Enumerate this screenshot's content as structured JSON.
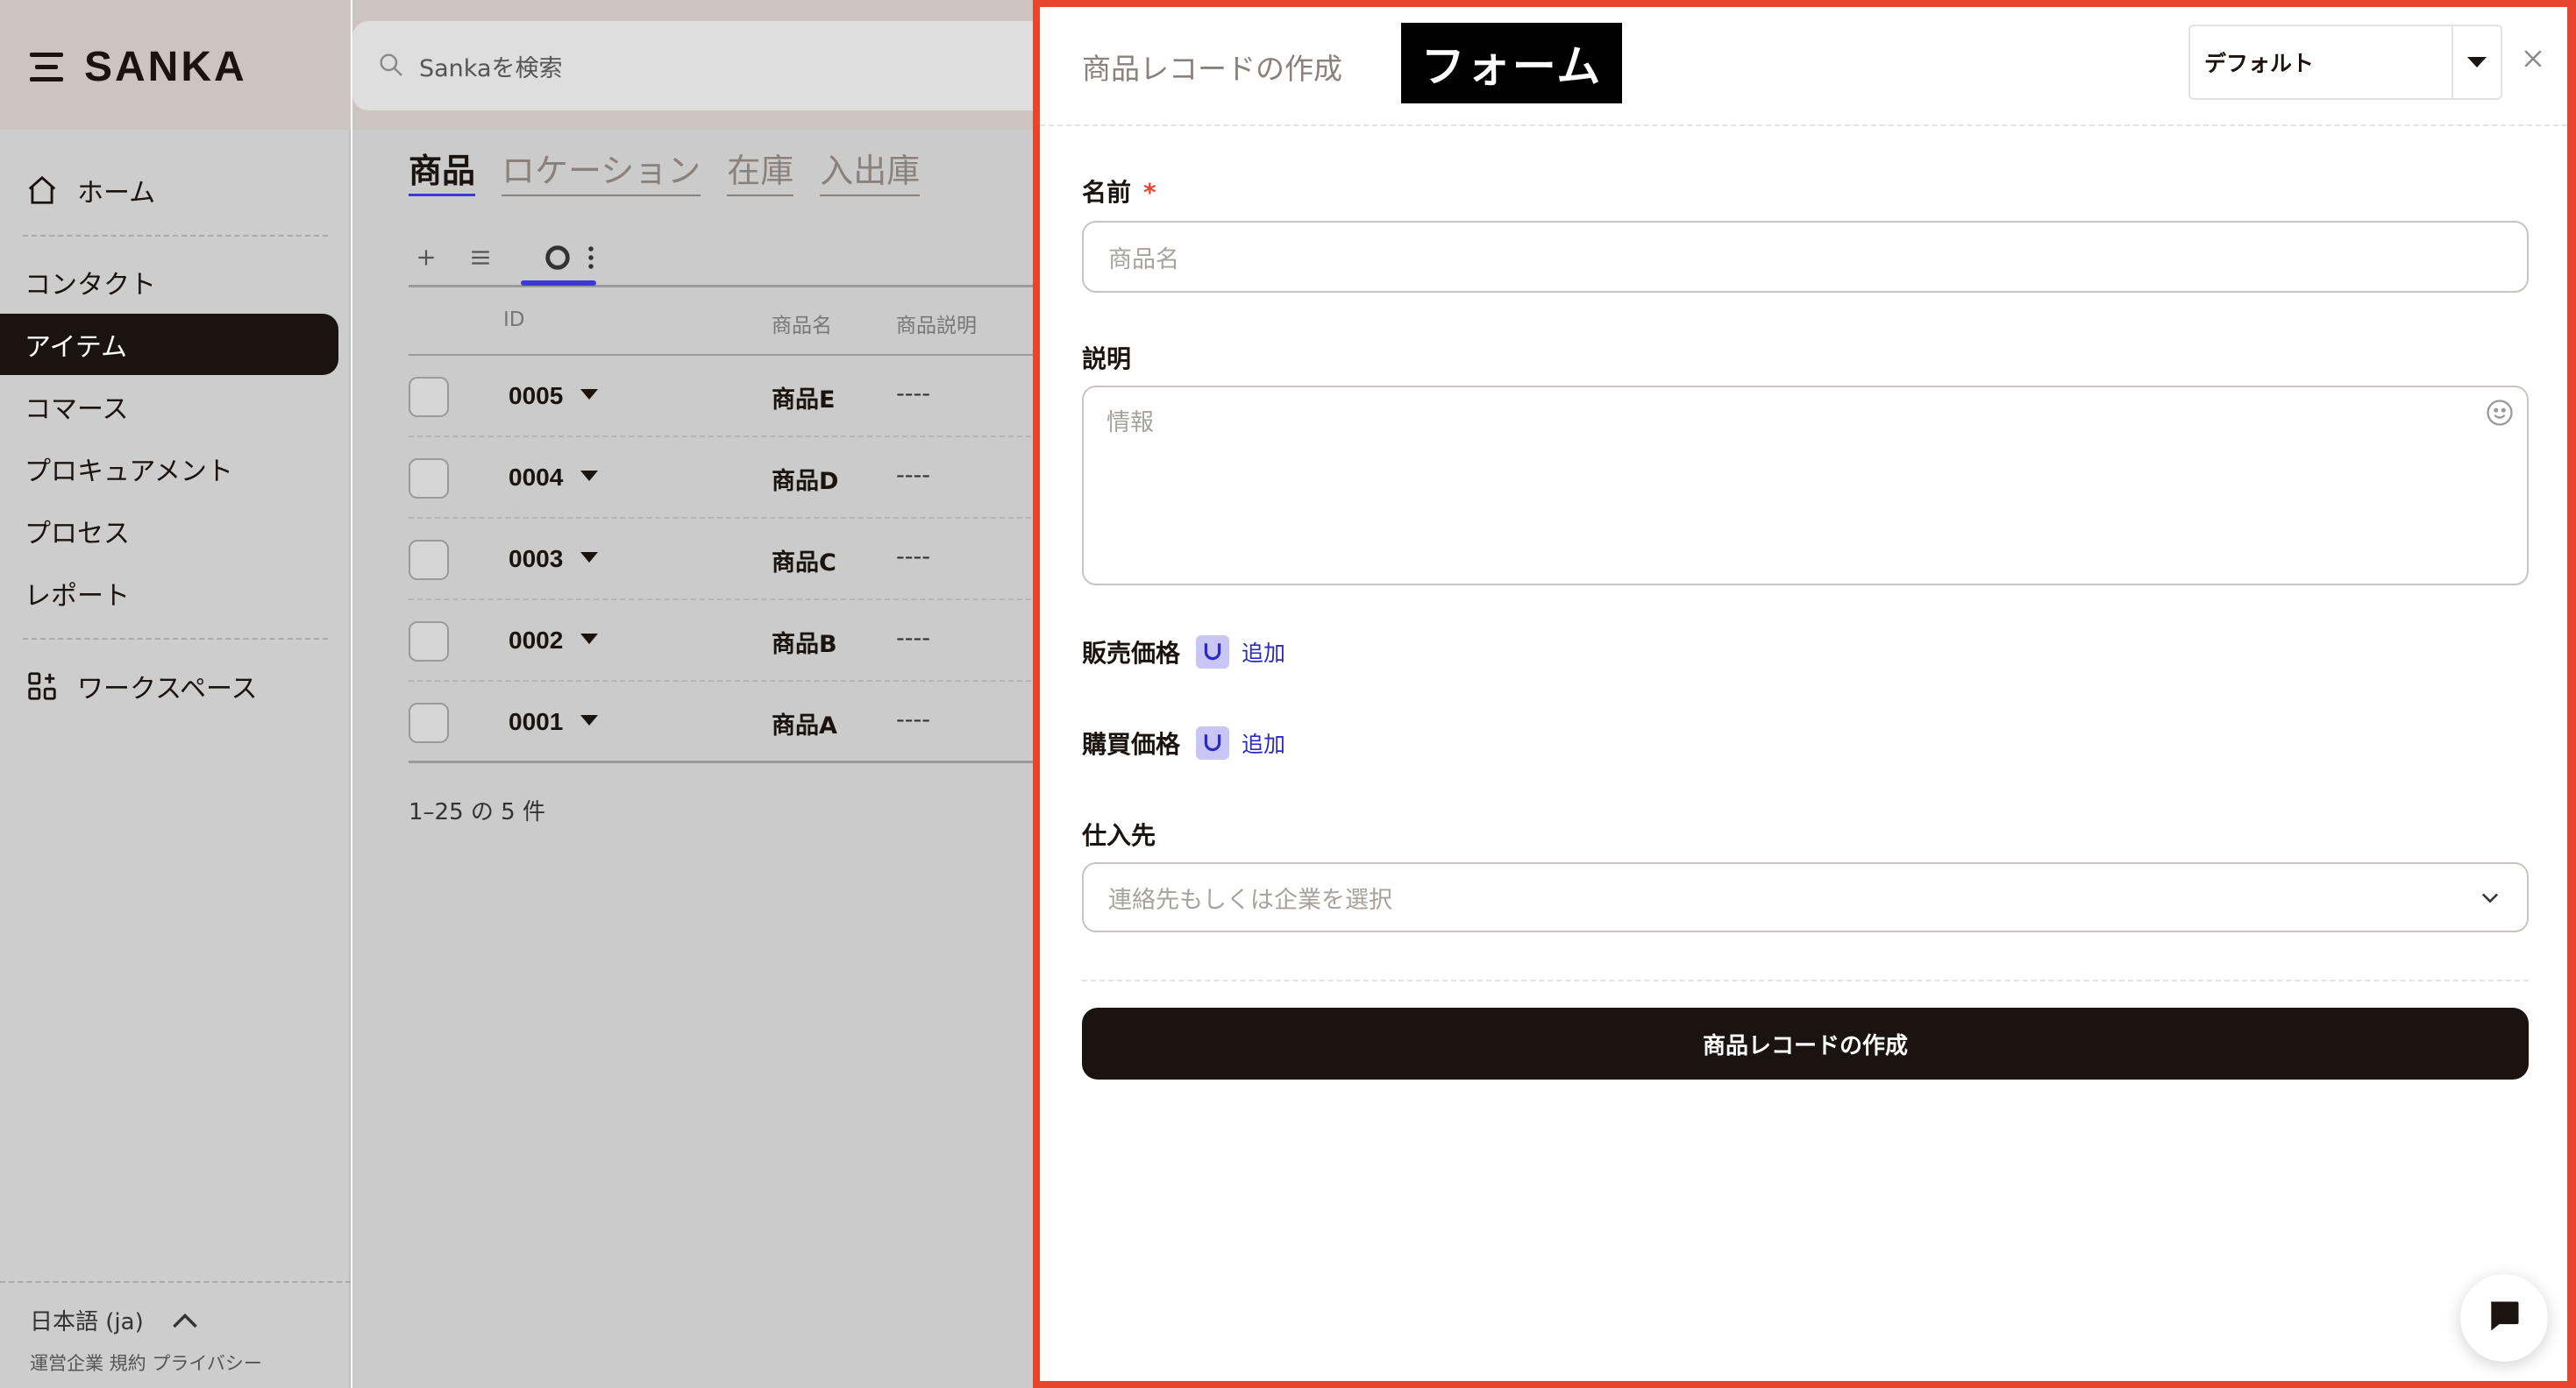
{
  "brand": {
    "name": "SANKA"
  },
  "search": {
    "placeholder": "Sankaを検索"
  },
  "sidebar": {
    "home": "ホーム",
    "items": [
      "コンタクト",
      "アイテム",
      "コマース",
      "プロキュアメント",
      "プロセス",
      "レポート"
    ],
    "workspace": "ワークスペース",
    "language": "日本語 (ja)",
    "footer_links": "運営企業 規約 プライバシー"
  },
  "tabs": [
    "商品",
    "ロケーション",
    "在庫",
    "入出庫"
  ],
  "table": {
    "headers": {
      "id": "ID",
      "name": "商品名",
      "desc": "商品説明"
    },
    "rows": [
      {
        "id": "0005",
        "name": "商品E",
        "desc": "----"
      },
      {
        "id": "0004",
        "name": "商品D",
        "desc": "----"
      },
      {
        "id": "0003",
        "name": "商品C",
        "desc": "----"
      },
      {
        "id": "0002",
        "name": "商品B",
        "desc": "----"
      },
      {
        "id": "0001",
        "name": "商品A",
        "desc": "----"
      }
    ],
    "count_text": "1–25 の 5 件"
  },
  "form": {
    "title": "商品レコードの作成",
    "badge": "フォーム",
    "preset_value": "デフォルト",
    "name_label": "名前",
    "required_mark": "*",
    "name_placeholder": "商品名",
    "desc_label": "説明",
    "desc_placeholder": "情報",
    "sale_price_label": "販売価格",
    "purchase_price_label": "購買価格",
    "add_label": "追加",
    "supplier_label": "仕入先",
    "supplier_placeholder": "連絡先もしくは企業を選択",
    "submit_label": "商品レコードの作成"
  },
  "colors": {
    "accent": "#3b3ad6",
    "highlight_border": "#e8452e",
    "dark": "#1b1310"
  }
}
